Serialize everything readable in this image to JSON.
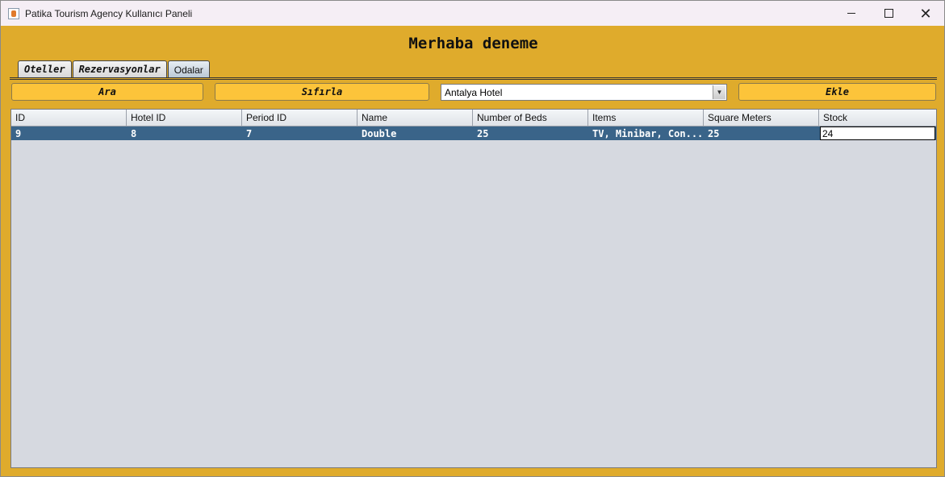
{
  "window": {
    "title": "Patika Tourism Agency Kullanıcı Paneli"
  },
  "greeting": "Merhaba deneme",
  "tabs": [
    {
      "label": "Oteller",
      "active": false
    },
    {
      "label": "Rezervasyonlar",
      "active": false
    },
    {
      "label": "Odalar",
      "active": true
    }
  ],
  "toolbar": {
    "search_label": "Ara",
    "reset_label": "Sıfırla",
    "hotel_selected": "Antalya Hotel",
    "add_label": "Ekle"
  },
  "table": {
    "columns": [
      "ID",
      "Hotel ID",
      "Period ID",
      "Name",
      "Number of Beds",
      "Items",
      "Square Meters",
      "Stock"
    ],
    "rows": [
      [
        "9",
        "8",
        "7",
        "Double",
        "25",
        "TV, Minibar, Con...",
        "25",
        "24"
      ]
    ]
  },
  "colors": {
    "background": "#dfab2c",
    "button": "#fcc43a",
    "selected_row": "#3a6489",
    "table_bg": "#d6d9e0"
  }
}
